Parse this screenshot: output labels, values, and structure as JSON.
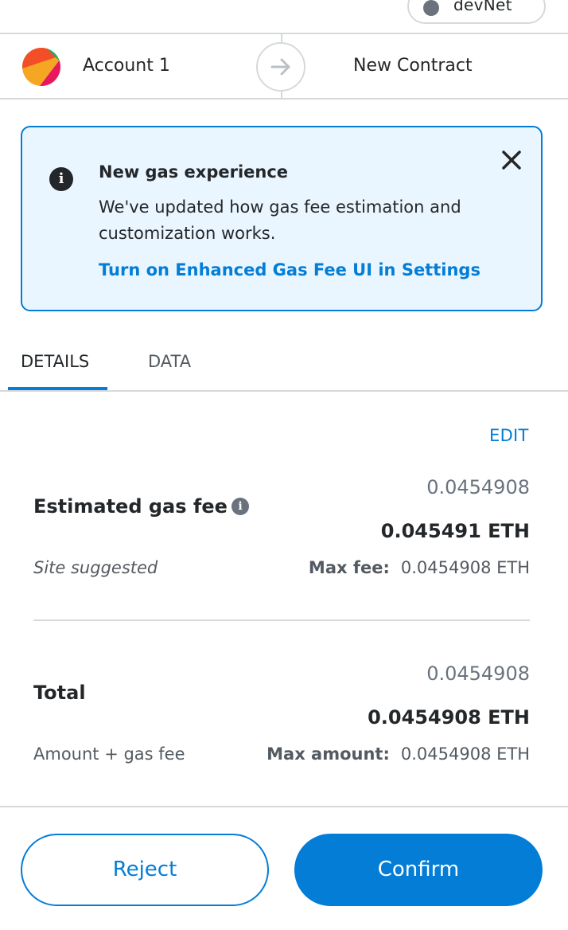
{
  "network": {
    "label": "devNet"
  },
  "transaction": {
    "sender": "Account 1",
    "recipient": "New Contract"
  },
  "notice": {
    "title": "New gas experience",
    "body": "We've updated how gas fee estimation and customization works.",
    "link": "Turn on Enhanced Gas Fee UI in Settings"
  },
  "tabs": [
    {
      "label": "DETAILS",
      "active": true
    },
    {
      "label": "DATA",
      "active": false
    }
  ],
  "details": {
    "edit_label": "EDIT",
    "gas_fee": {
      "label": "Estimated gas fee",
      "secondary": "0.0454908",
      "primary": "0.045491 ETH",
      "note": "Site suggested",
      "max_label": "Max fee:",
      "max_value": "0.0454908 ETH"
    },
    "total": {
      "label": "Total",
      "secondary": "0.0454908",
      "primary": "0.0454908 ETH",
      "note": "Amount + gas fee",
      "max_label": "Max amount:",
      "max_value": "0.0454908 ETH"
    }
  },
  "footer": {
    "reject_label": "Reject",
    "confirm_label": "Confirm"
  },
  "colors": {
    "accent": "#037dd6",
    "notice_bg": "#eaf6ff"
  }
}
